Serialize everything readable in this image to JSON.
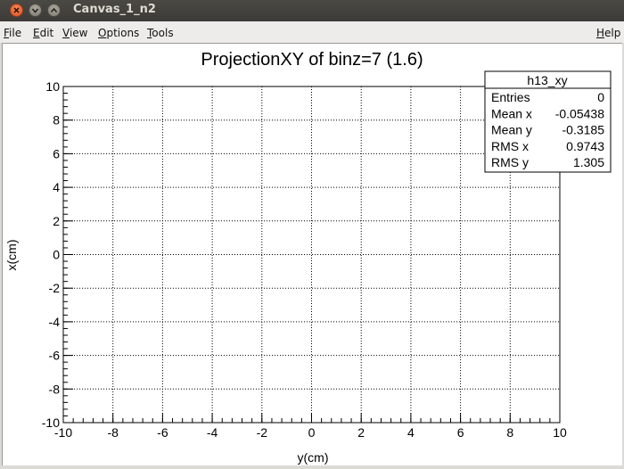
{
  "window": {
    "title": "Canvas_1_n2"
  },
  "menu": {
    "file": {
      "u": "F",
      "rest": "ile"
    },
    "edit": {
      "u": "E",
      "rest": "dit"
    },
    "view": {
      "u": "V",
      "rest": "iew"
    },
    "options": {
      "u": "O",
      "rest": "ptions"
    },
    "tools": {
      "u": "T",
      "rest": "ools"
    },
    "help": {
      "u": "H",
      "rest": "elp"
    }
  },
  "chart_data": {
    "type": "heatmap",
    "title": "ProjectionXY of binz=7 (1.6)",
    "xlabel": "y(cm)",
    "ylabel": "x(cm)",
    "xlim": [
      -10,
      10
    ],
    "ylim": [
      -10,
      10
    ],
    "xticks": [
      "-10",
      "-8",
      "-6",
      "-4",
      "-2",
      "0",
      "2",
      "4",
      "6",
      "8",
      "10"
    ],
    "yticks": [
      "-10",
      "-8",
      "-6",
      "-4",
      "-2",
      "0",
      "2",
      "4",
      "6",
      "8",
      "10"
    ],
    "grid": true,
    "values": [],
    "stats": {
      "name": "h13_xy",
      "rows": [
        {
          "label": "Entries",
          "value": "0"
        },
        {
          "label": "Mean x",
          "value": "-0.05438"
        },
        {
          "label": "Mean y",
          "value": "-0.3185"
        },
        {
          "label": "RMS x",
          "value": "0.9743"
        },
        {
          "label": "RMS y",
          "value": "1.305"
        }
      ]
    }
  }
}
